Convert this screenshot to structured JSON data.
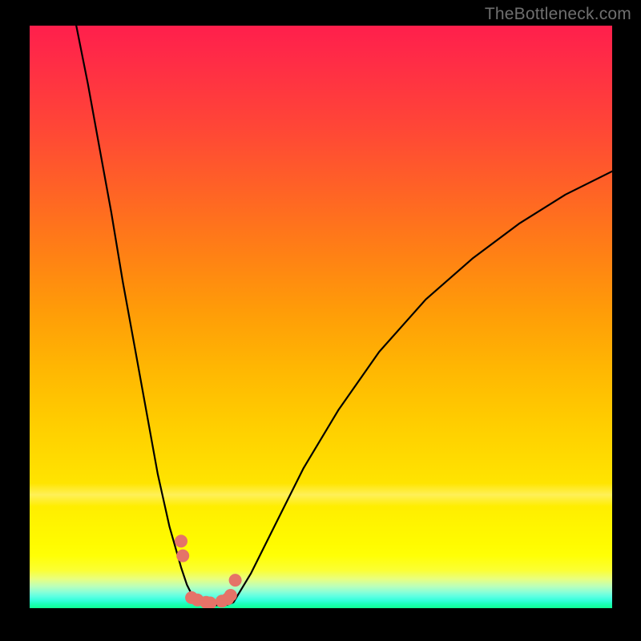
{
  "watermark": "TheBottleneck.com",
  "chart_data": {
    "type": "line",
    "title": "",
    "xlabel": "",
    "ylabel": "",
    "xlim": [
      0,
      100
    ],
    "ylim": [
      0,
      100
    ],
    "axes_visible": false,
    "grid": false,
    "background": "rainbow-gradient-vertical",
    "gradient_stops": [
      {
        "pos": 0.0,
        "color": "#ff1f4c"
      },
      {
        "pos": 0.49,
        "color": "#ff9c08"
      },
      {
        "pos": 0.78,
        "color": "#ffe300"
      },
      {
        "pos": 0.95,
        "color": "#e8ff80"
      },
      {
        "pos": 1.0,
        "color": "#10ff93"
      }
    ],
    "series": [
      {
        "name": "left-branch",
        "stroke": "#000000",
        "stroke_width": 2,
        "x": [
          8,
          10,
          12,
          14,
          16,
          18,
          20,
          22,
          24,
          26,
          27,
          28,
          28.5
        ],
        "y": [
          100,
          90,
          79,
          68,
          56,
          45,
          34,
          23,
          14,
          7,
          4,
          2,
          1
        ]
      },
      {
        "name": "flat-valley",
        "stroke": "#000000",
        "stroke_width": 2,
        "x": [
          28.5,
          30,
          32,
          34,
          35
        ],
        "y": [
          1,
          0.5,
          0.5,
          0.6,
          1
        ]
      },
      {
        "name": "right-branch",
        "stroke": "#000000",
        "stroke_width": 2,
        "x": [
          35,
          38,
          42,
          47,
          53,
          60,
          68,
          76,
          84,
          92,
          100
        ],
        "y": [
          1,
          6,
          14,
          24,
          34,
          44,
          53,
          60,
          66,
          71,
          75
        ]
      },
      {
        "name": "valley-markers",
        "type": "scatter",
        "marker_color": "#e57368",
        "marker_radius": 8,
        "x": [
          26.0,
          26.3,
          27.8,
          28.8,
          30.3,
          31.0,
          33.0,
          34.0,
          34.5,
          35.3
        ],
        "y": [
          11.5,
          9.0,
          1.8,
          1.4,
          1.0,
          0.9,
          1.2,
          1.6,
          2.2,
          4.8
        ]
      }
    ],
    "notes": "No axis ticks or numeric labels are drawn; x and y are normalized 0–100 to the plot area. y=100 is top, y=0 is bottom."
  }
}
